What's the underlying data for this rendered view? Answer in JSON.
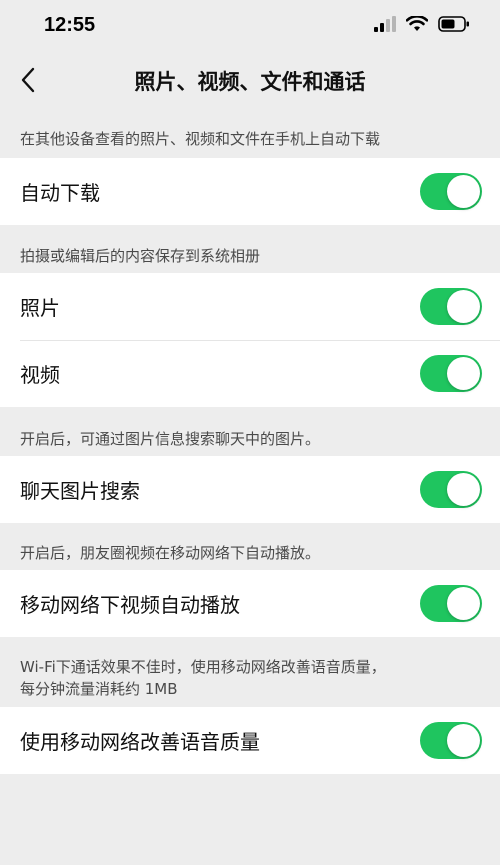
{
  "status": {
    "time": "12:55"
  },
  "nav": {
    "title": "照片、视频、文件和通话"
  },
  "sections": [
    {
      "caption": "在其他设备查看的照片、视频和文件在手机上自动下载",
      "rows": [
        {
          "label": "自动下载",
          "on": true
        }
      ]
    },
    {
      "caption": "拍摄或编辑后的内容保存到系统相册",
      "rows": [
        {
          "label": "照片",
          "on": true
        },
        {
          "label": "视频",
          "on": true
        }
      ]
    },
    {
      "caption": "开启后，可通过图片信息搜索聊天中的图片。",
      "rows": [
        {
          "label": "聊天图片搜索",
          "on": true
        }
      ]
    },
    {
      "caption": "开启后，朋友圈视频在移动网络下自动播放。",
      "rows": [
        {
          "label": "移动网络下视频自动播放",
          "on": true
        }
      ]
    },
    {
      "caption_line1": "Wi-Fi下通话效果不佳时，使用移动网络改善语音质量，",
      "caption_line2": "每分钟流量消耗约 1MB",
      "rows": [
        {
          "label": "使用移动网络改善语音质量",
          "on": true
        }
      ]
    }
  ],
  "colors": {
    "toggle_on": "#1fc55f",
    "background": "#ededed"
  }
}
